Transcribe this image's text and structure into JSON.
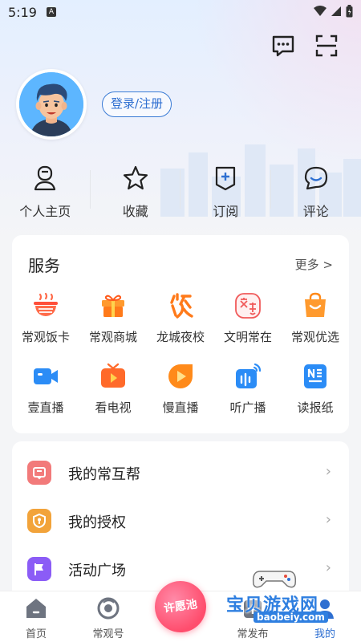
{
  "status_bar": {
    "time": "5:19",
    "badge": "A"
  },
  "header": {
    "login_label": "登录/注册"
  },
  "quick_actions": [
    {
      "label": "个人主页",
      "icon": "person-icon"
    },
    {
      "label": "收藏",
      "icon": "star-icon"
    },
    {
      "label": "订阅",
      "icon": "subscribe-plus-icon"
    },
    {
      "label": "评论",
      "icon": "comment-smile-icon"
    }
  ],
  "services": {
    "title": "服务",
    "more": "更多 >",
    "rows": [
      [
        {
          "label": "常观饭卡",
          "icon": "bowl-icon"
        },
        {
          "label": "常观商城",
          "icon": "gift-icon"
        },
        {
          "label": "龙城夜校",
          "icon": "night-school-icon"
        },
        {
          "label": "文明常在",
          "icon": "civility-icon"
        },
        {
          "label": "常观优选",
          "icon": "shopping-bag-icon"
        }
      ],
      [
        {
          "label": "壹直播",
          "icon": "video-camera-icon"
        },
        {
          "label": "看电视",
          "icon": "tv-icon"
        },
        {
          "label": "慢直播",
          "icon": "play-circle-icon"
        },
        {
          "label": "听广播",
          "icon": "radio-icon"
        },
        {
          "label": "读报纸",
          "icon": "newspaper-icon"
        }
      ]
    ]
  },
  "menu_list": [
    {
      "label": "我的常互帮",
      "icon": "help-chat-icon"
    },
    {
      "label": "我的授权",
      "icon": "key-shield-icon"
    },
    {
      "label": "活动广场",
      "icon": "flag-icon"
    }
  ],
  "tabbar": {
    "tabs": [
      {
        "label": "首页",
        "icon": "home-icon"
      },
      {
        "label": "常观号",
        "icon": "lens-icon"
      },
      {
        "label": "常发布",
        "icon": "publish-icon"
      },
      {
        "label": "我的",
        "icon": "user-icon"
      }
    ],
    "center_label": "许愿池"
  },
  "watermark": {
    "text": "宝贝游戏网",
    "url": "baobeiy.com"
  },
  "colors": {
    "accent": "#2e6fd1",
    "wish": "#ff4d6d"
  }
}
